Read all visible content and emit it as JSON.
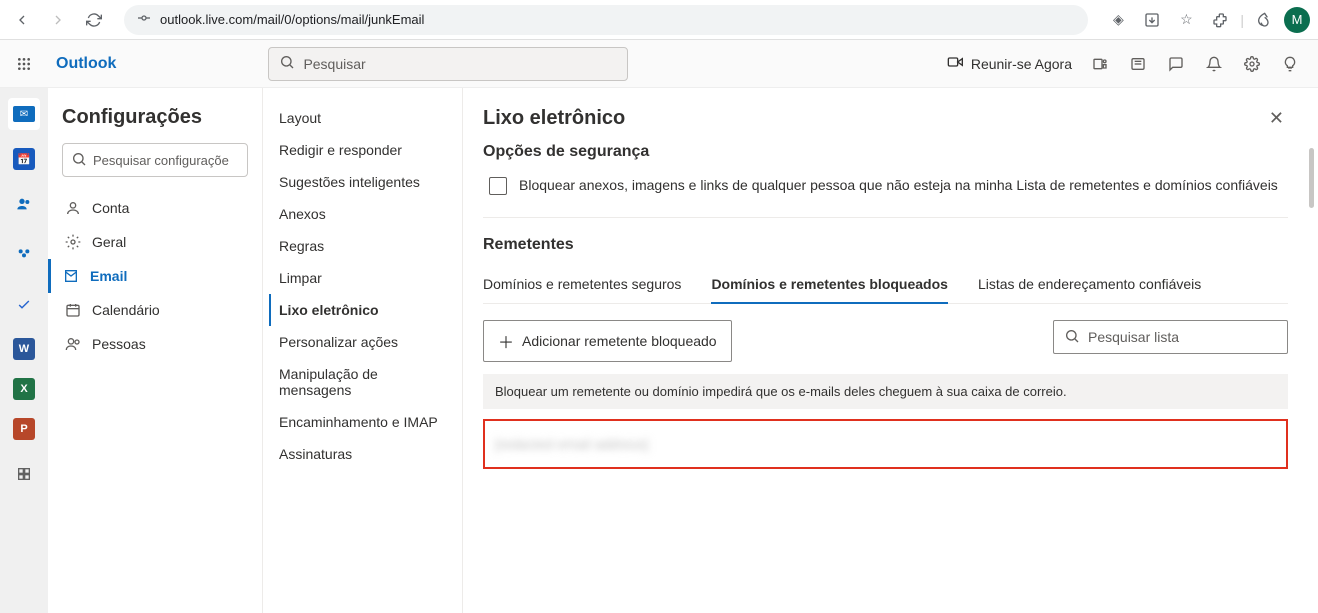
{
  "browser": {
    "url": "outlook.live.com/mail/0/options/mail/junkEmail",
    "avatar": "M"
  },
  "header": {
    "brand": "Outlook",
    "search_placeholder": "Pesquisar",
    "meet_now": "Reunir-se Agora"
  },
  "settings": {
    "title": "Configurações",
    "search_placeholder": "Pesquisar configuraçõe",
    "categories": [
      {
        "label": "Conta",
        "icon": "person"
      },
      {
        "label": "Geral",
        "icon": "gear"
      },
      {
        "label": "Email",
        "icon": "mail",
        "selected": true
      },
      {
        "label": "Calendário",
        "icon": "calendar"
      },
      {
        "label": "Pessoas",
        "icon": "people"
      }
    ],
    "subitems": [
      {
        "label": "Layout"
      },
      {
        "label": "Redigir e responder"
      },
      {
        "label": "Sugestões inteligentes"
      },
      {
        "label": "Anexos"
      },
      {
        "label": "Regras"
      },
      {
        "label": "Limpar"
      },
      {
        "label": "Lixo eletrônico",
        "selected": true
      },
      {
        "label": "Personalizar ações"
      },
      {
        "label": "Manipulação de mensagens"
      },
      {
        "label": "Encaminhamento e IMAP"
      },
      {
        "label": "Assinaturas"
      }
    ]
  },
  "content": {
    "title": "Lixo eletrônico",
    "security_heading": "Opções de segurança",
    "checkbox_label": "Bloquear anexos, imagens e links de qualquer pessoa que não esteja na minha Lista de remetentes e domínios confiáveis",
    "senders_heading": "Remetentes",
    "tabs": [
      {
        "label": "Domínios e remetentes seguros"
      },
      {
        "label": "Domínios e remetentes bloqueados",
        "active": true
      },
      {
        "label": "Listas de endereçamento confiáveis"
      }
    ],
    "add_button": "Adicionar remetente bloqueado",
    "search_list_placeholder": "Pesquisar lista",
    "info_banner": "Bloquear um remetente ou domínio impedirá que os e-mails deles cheguem à sua caixa de correio.",
    "blocked_items": [
      {
        "value": "[redacted email address]"
      }
    ]
  }
}
